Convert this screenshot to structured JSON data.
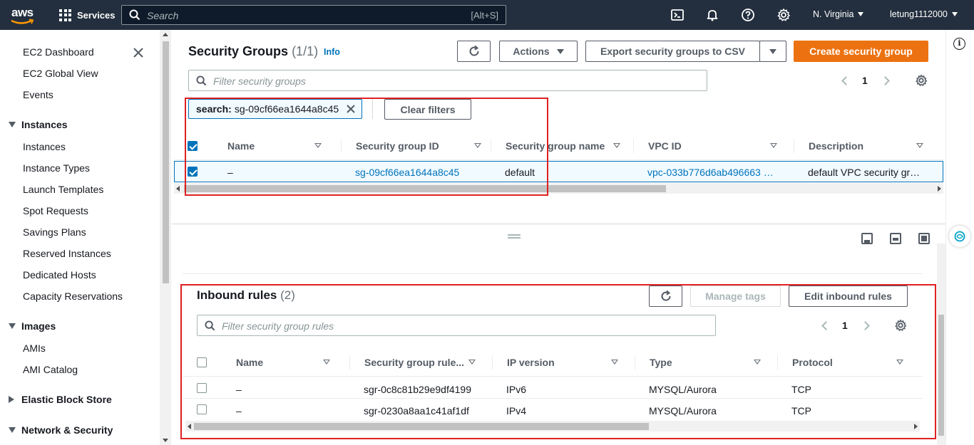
{
  "nav": {
    "logo": "aws",
    "services": "Services",
    "search_placeholder": "Search",
    "search_shortcut": "[Alt+S]",
    "region": "N. Virginia",
    "account": "letung1112000"
  },
  "sidebar": {
    "items": [
      {
        "label": "EC2 Dashboard"
      },
      {
        "label": "EC2 Global View"
      },
      {
        "label": "Events"
      }
    ],
    "groups": [
      {
        "label": "Instances",
        "expanded": true,
        "items": [
          "Instances",
          "Instance Types",
          "Launch Templates",
          "Spot Requests",
          "Savings Plans",
          "Reserved Instances",
          "Dedicated Hosts",
          "Capacity Reservations"
        ]
      },
      {
        "label": "Images",
        "expanded": true,
        "items": [
          "AMIs",
          "AMI Catalog"
        ]
      },
      {
        "label": "Elastic Block Store",
        "expanded": false,
        "items": []
      },
      {
        "label": "Network & Security",
        "expanded": true,
        "items": []
      }
    ]
  },
  "sg_panel": {
    "title": "Security Groups",
    "count": "(1/1)",
    "info": "Info",
    "actions": "Actions",
    "export": "Export security groups to CSV",
    "create": "Create security group",
    "filter_placeholder": "Filter security groups",
    "page": "1",
    "token_key": "search:",
    "token_value": "sg-09cf66ea1644a8c45",
    "clear_filters": "Clear filters",
    "columns": [
      "Name",
      "Security group ID",
      "Security group name",
      "VPC ID",
      "Description"
    ],
    "rows": [
      {
        "name": "–",
        "id": "sg-09cf66ea1644a8c45",
        "group_name": "default",
        "vpc": "vpc-033b776d6ab496663 …",
        "description": "default VPC security gr…",
        "selected": true
      }
    ]
  },
  "inbound": {
    "title": "Inbound rules",
    "count": "(2)",
    "manage_tags": "Manage tags",
    "edit": "Edit inbound rules",
    "filter_placeholder": "Filter security group rules",
    "page": "1",
    "columns": [
      "Name",
      "Security group rule...",
      "IP version",
      "Type",
      "Protocol"
    ],
    "rows": [
      {
        "name": "–",
        "rule_id": "sgr-0c8c81b29e9df4199",
        "ip": "IPv6",
        "type": "MYSQL/Aurora",
        "protocol": "TCP"
      },
      {
        "name": "–",
        "rule_id": "sgr-0230a8aa1c41af1df",
        "ip": "IPv4",
        "type": "MYSQL/Aurora",
        "protocol": "TCP"
      }
    ]
  },
  "colors": {
    "nav_bg": "#232f3e",
    "primary": "#ec7211",
    "link": "#0073bb",
    "highlight": "#e02020"
  }
}
